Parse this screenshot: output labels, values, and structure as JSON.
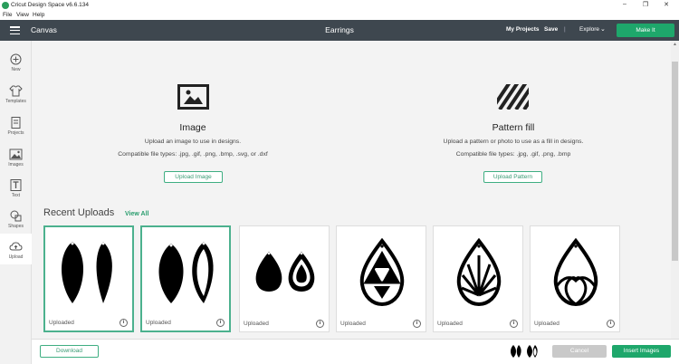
{
  "window": {
    "title": "Cricut Design Space  v6.6.134",
    "controls": [
      "–",
      "❐",
      "✕"
    ]
  },
  "menu": [
    "File",
    "View",
    "Help"
  ],
  "header": {
    "canvas_label": "Canvas",
    "project_name": "Earrings",
    "my_projects": "My Projects",
    "save": "Save",
    "separator": "|",
    "explore": "Explore",
    "explore_chevron": "⌄",
    "make_it": "Make It"
  },
  "sidebar": {
    "items": [
      {
        "label": "New",
        "icon": "plus-circle-icon"
      },
      {
        "label": "Templates",
        "icon": "shirt-icon"
      },
      {
        "label": "Projects",
        "icon": "projects-icon"
      },
      {
        "label": "Images",
        "icon": "image-icon"
      },
      {
        "label": "Text",
        "icon": "text-icon"
      },
      {
        "label": "Shapes",
        "icon": "shapes-icon"
      },
      {
        "label": "Upload",
        "icon": "upload-cloud-icon",
        "active": true
      }
    ]
  },
  "upload_options": {
    "image": {
      "title": "Image",
      "description": "Upload an image to use in designs.",
      "file_types": "Compatible file types: .jpg, .gif, .png, .bmp, .svg, or .dxf",
      "button": "Upload Image"
    },
    "pattern": {
      "title": "Pattern fill",
      "description": "Upload a pattern or photo to use as a fill in designs.",
      "file_types": "Compatible file types: .jpg, .gif, .png, .bmp",
      "button": "Upload Pattern"
    }
  },
  "recent": {
    "title": "Recent Uploads",
    "view_all": "View All",
    "items": [
      {
        "caption": "Uploaded",
        "selected": true,
        "art": "leaf-pair-earrings"
      },
      {
        "caption": "Uploaded",
        "selected": true,
        "art": "leaf-and-cutout-earrings"
      },
      {
        "caption": "Uploaded",
        "selected": false,
        "art": "teardrop-pair-earrings"
      },
      {
        "caption": "Uploaded",
        "selected": false,
        "art": "triangle-teardrop-earring"
      },
      {
        "caption": "Uploaded",
        "selected": false,
        "art": "sunburst-teardrop-earring"
      },
      {
        "caption": "Uploaded",
        "selected": false,
        "art": "looped-teardrop-earring"
      }
    ],
    "info_glyph": "i"
  },
  "footer": {
    "download": "Download",
    "cancel": "Cancel",
    "insert": "Insert Images"
  },
  "colors": {
    "header_bg": "#3e474f",
    "accent_green": "#1ea76b",
    "selected_border": "#4cb18e"
  }
}
